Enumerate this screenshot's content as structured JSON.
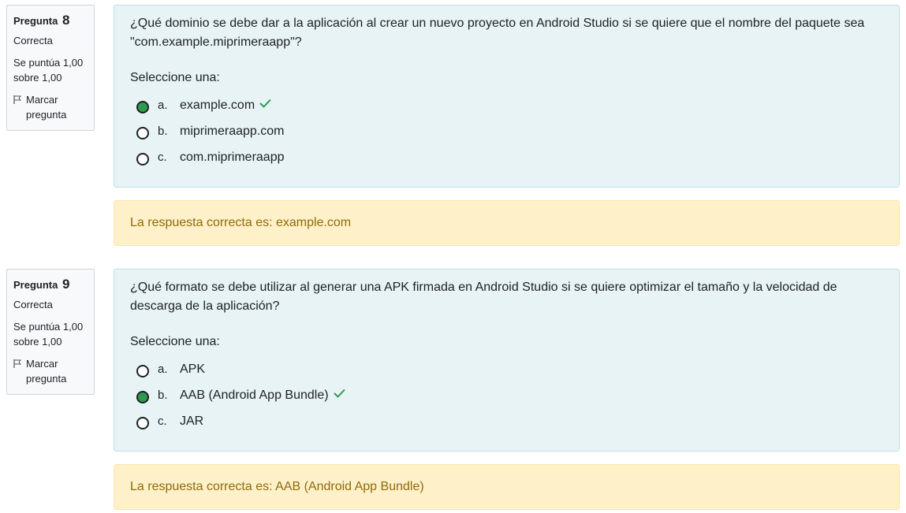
{
  "questions": [
    {
      "label": "Pregunta",
      "number": "8",
      "state": "Correcta",
      "grade": "Se puntúa 1,00 sobre 1,00",
      "flag_label": "Marcar pregunta",
      "text": "¿Qué dominio se debe dar a la aplicación al crear un nuevo proyecto en Android Studio si se quiere que el nombre del paquete sea \"com.example.miprimeraapp\"?",
      "prompt": "Seleccione una:",
      "answers": [
        {
          "letter": "a.",
          "text": "example.com",
          "selected": true,
          "correct": true
        },
        {
          "letter": "b.",
          "text": "miprimeraapp.com",
          "selected": false,
          "correct": false
        },
        {
          "letter": "c.",
          "text": "com.miprimeraapp",
          "selected": false,
          "correct": false
        }
      ],
      "feedback": "La respuesta correcta es: example.com"
    },
    {
      "label": "Pregunta",
      "number": "9",
      "state": "Correcta",
      "grade": "Se puntúa 1,00 sobre 1,00",
      "flag_label": "Marcar pregunta",
      "text": "¿Qué formato se debe utilizar al generar una APK firmada en Android Studio si se quiere optimizar el tamaño y la velocidad de descarga de la aplicación?",
      "prompt": "Seleccione una:",
      "answers": [
        {
          "letter": "a.",
          "text": "APK",
          "selected": false,
          "correct": false
        },
        {
          "letter": "b.",
          "text": "AAB (Android App Bundle)",
          "selected": true,
          "correct": true
        },
        {
          "letter": "c.",
          "text": "JAR",
          "selected": false,
          "correct": false
        }
      ],
      "feedback": "La respuesta correcta es: AAB (Android App Bundle)"
    }
  ],
  "colors": {
    "selected_radio": "#2e9a4e",
    "check_mark": "#2e9a4e",
    "formulation_bg": "#e7f3f5",
    "feedback_bg": "#fef1c9",
    "feedback_text": "#8e6a0b"
  },
  "icons": {
    "flag": "flag-icon",
    "correct": "check-icon"
  }
}
